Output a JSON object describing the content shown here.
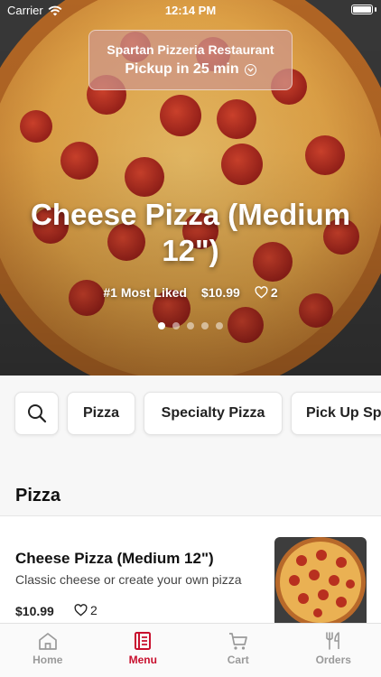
{
  "status_bar": {
    "carrier": "Carrier",
    "time": "12:14 PM"
  },
  "pickup": {
    "restaurant": "Spartan Pizzeria Restaurant",
    "time_text": "Pickup in 25 min"
  },
  "hero": {
    "title": "Cheese Pizza (Medium 12\")",
    "badge": "#1 Most Liked",
    "price": "$10.99",
    "likes": "2",
    "slide_count": 5,
    "active_slide": 1
  },
  "categories": {
    "search_icon": "search-icon",
    "items": [
      "Pizza",
      "Specialty Pizza",
      "Pick Up Sp"
    ]
  },
  "section": {
    "title": "Pizza"
  },
  "menu_item": {
    "name": "Cheese Pizza (Medium 12\")",
    "description": "Classic cheese or create your own pizza",
    "price": "$10.99",
    "likes": "2"
  },
  "tabs": [
    {
      "label": "Home",
      "icon": "home-icon",
      "active": false
    },
    {
      "label": "Menu",
      "icon": "menu-icon",
      "active": true
    },
    {
      "label": "Cart",
      "icon": "cart-icon",
      "active": false
    },
    {
      "label": "Orders",
      "icon": "orders-icon",
      "active": false
    }
  ],
  "colors": {
    "accent": "#c8102e",
    "inactive_tab": "#9a9a9a"
  }
}
